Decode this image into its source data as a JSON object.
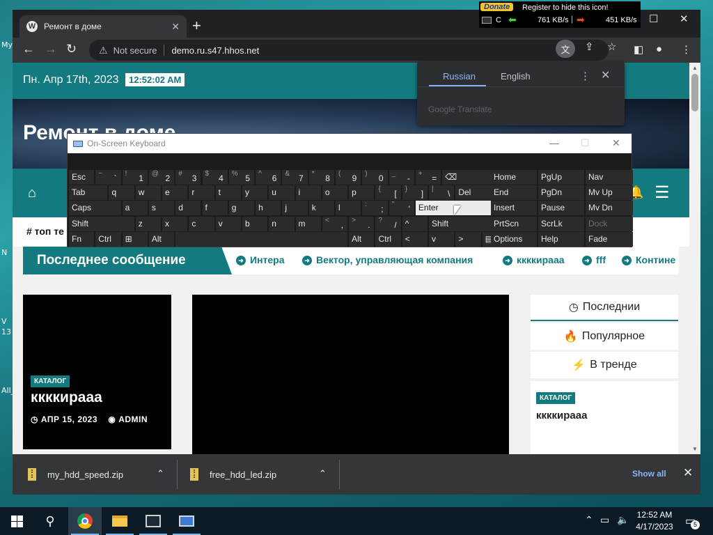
{
  "desktop": {
    "fragments": [
      "My",
      "N",
      "V",
      "13",
      "All_"
    ]
  },
  "browser": {
    "tab_title": "Ремонт в доме",
    "tab_favicon": "W",
    "new_tab": "+",
    "not_secure": "Not secure",
    "url": "demo.ru.s47.hhos.net"
  },
  "netmon": {
    "donate": "Donate",
    "register": "Register to hide this icon!",
    "drive": "C",
    "recv": "761 KB/s",
    "separator": "|",
    "send": "451 KB/s"
  },
  "site": {
    "date": "Пн. Апр 17th, 2023",
    "clock": "12:52:02 AM",
    "title": "Ремонт в доме",
    "tag_label": "# топ те",
    "ticker_head": "Последнее сообщение",
    "ticker_items": [
      "Интера",
      "Вектор, управляющая компания",
      "ккккираaa",
      "fff",
      "Контине"
    ],
    "card": {
      "badge": "КАТАЛОГ",
      "title": "ккккираaa",
      "date": "АПР 15, 2023",
      "author": "ADMIN"
    },
    "sidebar": {
      "tabs": [
        "Последнии",
        "Популярное",
        "В тренде"
      ],
      "post_badge": "КАТАЛОГ",
      "post_title": "ккккираaa"
    }
  },
  "translate": {
    "lang_active": "Russian",
    "lang_other": "English",
    "provider": "Google Translate"
  },
  "osk": {
    "title": "On-Screen Keyboard",
    "keys": [
      {
        "r": 0,
        "c": 0,
        "w": 1,
        "m": "Esc"
      },
      {
        "r": 0,
        "c": 1,
        "w": 1,
        "s": "~",
        "p": "`"
      },
      {
        "r": 0,
        "c": 2,
        "w": 1,
        "s": "!",
        "p": "1"
      },
      {
        "r": 0,
        "c": 3,
        "w": 1,
        "s": "@",
        "p": "2"
      },
      {
        "r": 0,
        "c": 4,
        "w": 1,
        "s": "#",
        "p": "3"
      },
      {
        "r": 0,
        "c": 5,
        "w": 1,
        "s": "$",
        "p": "4"
      },
      {
        "r": 0,
        "c": 6,
        "w": 1,
        "s": "%",
        "p": "5"
      },
      {
        "r": 0,
        "c": 7,
        "w": 1,
        "s": "^",
        "p": "6"
      },
      {
        "r": 0,
        "c": 8,
        "w": 1,
        "s": "&",
        "p": "7"
      },
      {
        "r": 0,
        "c": 9,
        "w": 1,
        "s": "*",
        "p": "8"
      },
      {
        "r": 0,
        "c": 10,
        "w": 1,
        "s": "(",
        "p": "9"
      },
      {
        "r": 0,
        "c": 11,
        "w": 1,
        "s": ")",
        "p": "0"
      },
      {
        "r": 0,
        "c": 12,
        "w": 1,
        "s": "_",
        "p": "-"
      },
      {
        "r": 0,
        "c": 13,
        "w": 1,
        "s": "+",
        "p": "="
      },
      {
        "r": 0,
        "c": 14,
        "w": 2,
        "m": "⌫"
      },
      {
        "r": 1,
        "c": 0,
        "w": 1.5,
        "m": "Tab"
      },
      {
        "r": 1,
        "c": 1.5,
        "w": 1,
        "m": "q"
      },
      {
        "r": 1,
        "c": 2.5,
        "w": 1,
        "m": "w"
      },
      {
        "r": 1,
        "c": 3.5,
        "w": 1,
        "m": "e"
      },
      {
        "r": 1,
        "c": 4.5,
        "w": 1,
        "m": "r"
      },
      {
        "r": 1,
        "c": 5.5,
        "w": 1,
        "m": "t"
      },
      {
        "r": 1,
        "c": 6.5,
        "w": 1,
        "m": "y"
      },
      {
        "r": 1,
        "c": 7.5,
        "w": 1,
        "m": "u"
      },
      {
        "r": 1,
        "c": 8.5,
        "w": 1,
        "m": "i"
      },
      {
        "r": 1,
        "c": 9.5,
        "w": 1,
        "m": "o"
      },
      {
        "r": 1,
        "c": 10.5,
        "w": 1,
        "m": "p"
      },
      {
        "r": 1,
        "c": 11.5,
        "w": 1,
        "s": "{",
        "p": "["
      },
      {
        "r": 1,
        "c": 12.5,
        "w": 1,
        "s": "}",
        "p": "]"
      },
      {
        "r": 1,
        "c": 13.5,
        "w": 1,
        "s": "|",
        "p": "\\"
      },
      {
        "r": 1,
        "c": 14.5,
        "w": 1.5,
        "m": "Del"
      },
      {
        "r": 2,
        "c": 0,
        "w": 2,
        "m": "Caps"
      },
      {
        "r": 2,
        "c": 2,
        "w": 1,
        "m": "a"
      },
      {
        "r": 2,
        "c": 3,
        "w": 1,
        "m": "s"
      },
      {
        "r": 2,
        "c": 4,
        "w": 1,
        "m": "d"
      },
      {
        "r": 2,
        "c": 5,
        "w": 1,
        "m": "f"
      },
      {
        "r": 2,
        "c": 6,
        "w": 1,
        "m": "g"
      },
      {
        "r": 2,
        "c": 7,
        "w": 1,
        "m": "h"
      },
      {
        "r": 2,
        "c": 8,
        "w": 1,
        "m": "j"
      },
      {
        "r": 2,
        "c": 9,
        "w": 1,
        "m": "k"
      },
      {
        "r": 2,
        "c": 10,
        "w": 1,
        "m": "l"
      },
      {
        "r": 2,
        "c": 11,
        "w": 1,
        "s": ":",
        "p": ";"
      },
      {
        "r": 2,
        "c": 12,
        "w": 1,
        "s": "\"",
        "p": "'"
      },
      {
        "r": 2,
        "c": 13,
        "w": 3,
        "m": "Enter",
        "enter": true
      },
      {
        "r": 3,
        "c": 0,
        "w": 2.5,
        "m": "Shift"
      },
      {
        "r": 3,
        "c": 2.5,
        "w": 1,
        "m": "z"
      },
      {
        "r": 3,
        "c": 3.5,
        "w": 1,
        "m": "x"
      },
      {
        "r": 3,
        "c": 4.5,
        "w": 1,
        "m": "c"
      },
      {
        "r": 3,
        "c": 5.5,
        "w": 1,
        "m": "v"
      },
      {
        "r": 3,
        "c": 6.5,
        "w": 1,
        "m": "b"
      },
      {
        "r": 3,
        "c": 7.5,
        "w": 1,
        "m": "n"
      },
      {
        "r": 3,
        "c": 8.5,
        "w": 1,
        "m": "m"
      },
      {
        "r": 3,
        "c": 9.5,
        "w": 1,
        "s": "<",
        "p": ","
      },
      {
        "r": 3,
        "c": 10.5,
        "w": 1,
        "s": ">",
        "p": "."
      },
      {
        "r": 3,
        "c": 11.5,
        "w": 1,
        "s": "?",
        "p": "/"
      },
      {
        "r": 3,
        "c": 12.5,
        "w": 1,
        "m": "^"
      },
      {
        "r": 3,
        "c": 13.5,
        "w": 2.5,
        "m": "Shift"
      },
      {
        "r": 4,
        "c": 0,
        "w": 1,
        "m": "Fn"
      },
      {
        "r": 4,
        "c": 1,
        "w": 1,
        "m": "Ctrl"
      },
      {
        "r": 4,
        "c": 2,
        "w": 1,
        "m": "⊞"
      },
      {
        "r": 4,
        "c": 3,
        "w": 1,
        "m": "Alt"
      },
      {
        "r": 4,
        "c": 4,
        "w": 6.5,
        "m": ""
      },
      {
        "r": 4,
        "c": 10.5,
        "w": 1,
        "m": "Alt"
      },
      {
        "r": 4,
        "c": 11.5,
        "w": 1,
        "m": "Ctrl"
      },
      {
        "r": 4,
        "c": 12.5,
        "w": 1,
        "m": "<"
      },
      {
        "r": 4,
        "c": 13.5,
        "w": 1,
        "m": "v"
      },
      {
        "r": 4,
        "c": 14.5,
        "w": 1,
        "m": ">"
      },
      {
        "r": 4,
        "c": 15.5,
        "w": 0.5,
        "m": "▤"
      }
    ],
    "nav_keys": [
      [
        "Home",
        "PgUp",
        "Nav"
      ],
      [
        "End",
        "PgDn",
        "Mv Up"
      ],
      [
        "Insert",
        "Pause",
        "Mv Dn"
      ],
      [
        "PrtScn",
        "ScrLk",
        "Dock"
      ],
      [
        "Options",
        "Help",
        "Fade"
      ]
    ]
  },
  "downloads": {
    "items": [
      "my_hdd_speed.zip",
      "free_hdd_led.zip"
    ],
    "show_all": "Show all"
  },
  "taskbar": {
    "time": "12:52 AM",
    "date": "4/17/2023",
    "notifications": "5"
  }
}
